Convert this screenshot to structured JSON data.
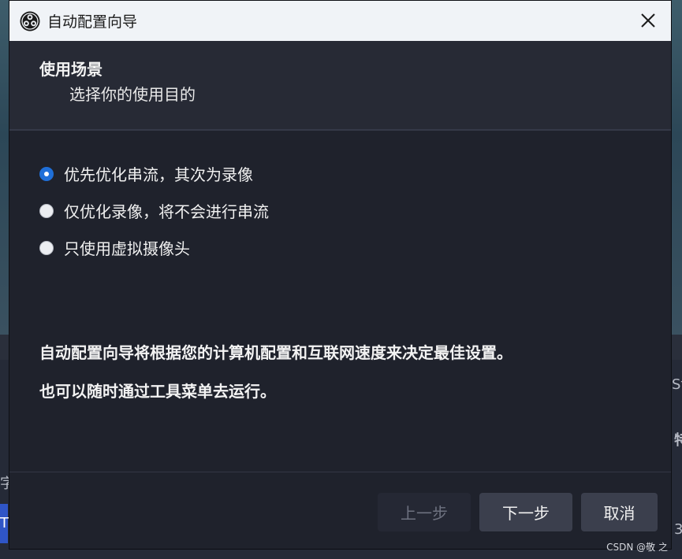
{
  "window": {
    "title": "自动配置向导",
    "icon": "obs-logo-icon"
  },
  "header": {
    "title": "使用场景",
    "subtitle": "选择你的使用目的"
  },
  "options": [
    {
      "label": "优先优化串流，其次为录像",
      "selected": true
    },
    {
      "label": "仅优化录像，将不会进行串流",
      "selected": false
    },
    {
      "label": "只使用虚拟摄像头",
      "selected": false
    }
  ],
  "info": {
    "line1": "自动配置向导将根据您的计算机配置和互联网速度来决定最佳设置。",
    "line2": "也可以随时通过工具菜单去运行。"
  },
  "buttons": {
    "prev": "上一步",
    "next": "下一步",
    "cancel": "取消"
  },
  "background": {
    "edge_text_1": "St",
    "edge_text_2": "特",
    "edge_text_3": "字",
    "edge_text_4": "T",
    "edge_text_5": "3"
  },
  "watermark": "CSDN @敬 之",
  "colors": {
    "accent": "#1f6fd8",
    "dialog_bg": "#1f222c",
    "titlebar_bg": "#f0f3f7"
  }
}
